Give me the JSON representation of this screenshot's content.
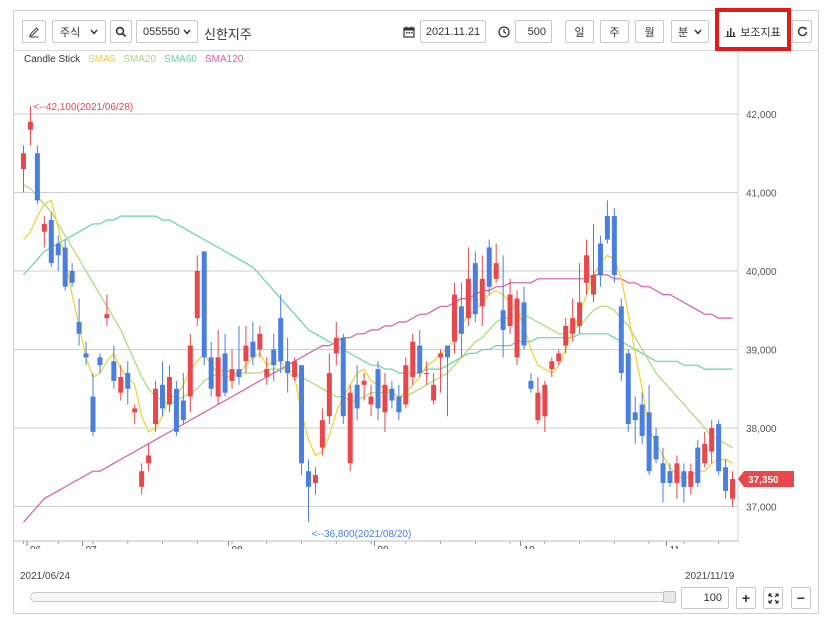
{
  "toolbar": {
    "edit_icon": "pencil-icon",
    "market_select": "주식",
    "search_icon": "search-icon",
    "code_select": "055550",
    "stock_name": "신한지주",
    "calendar_icon": "calendar-icon",
    "date_value": "2021.11.21",
    "clock_icon": "clock-icon",
    "count_value": "500",
    "period_day": "일",
    "period_week": "주",
    "period_month": "월",
    "period_minute": "분",
    "indicator_label": "보조지표",
    "refresh_icon": "refresh-icon"
  },
  "legend": {
    "candle": "Candle Stick",
    "sma5": "SMA5",
    "sma20": "SMA20",
    "sma60": "SMA60",
    "sma120": "SMA120"
  },
  "colors": {
    "up": "#e8474c",
    "down": "#4a7fe0",
    "sma5": "#f2d12e",
    "sma20": "#a9dc72",
    "sma60": "#66d6a6",
    "sma120": "#d65ea9",
    "highlight": "#e41919",
    "price_tag": "#e8474c"
  },
  "chart_data": {
    "type": "candlestick",
    "y_ticks": [
      "42,000",
      "41,000",
      "40,000",
      "39,000",
      "38,000",
      "37,000"
    ],
    "ylim": [
      36600,
      42400
    ],
    "x_ticks": [
      "06",
      "07",
      "08",
      "09",
      "10",
      "11"
    ],
    "high_annotation": "<--42,100(2021/06/28)",
    "low_annotation": "<--36,800(2021/08/20)",
    "current_price": "37,350",
    "start_date": "2021/06/24",
    "end_date": "2021/11/19",
    "candles": [
      [
        41300,
        41500,
        41000,
        41600,
        "u"
      ],
      [
        41800,
        41900,
        41600,
        42100,
        "u"
      ],
      [
        41500,
        40900,
        40850,
        41600,
        "d"
      ],
      [
        40500,
        40600,
        40300,
        40700,
        "u"
      ],
      [
        40650,
        40100,
        40050,
        40750,
        "d"
      ],
      [
        40350,
        40200,
        40000,
        40450,
        "d"
      ],
      [
        40300,
        39800,
        39750,
        40400,
        "d"
      ],
      [
        40000,
        39850,
        39800,
        40100,
        "d"
      ],
      [
        39350,
        39200,
        39050,
        39650,
        "d"
      ],
      [
        38950,
        38900,
        38800,
        39100,
        "d"
      ],
      [
        38400,
        37950,
        37900,
        38700,
        "d"
      ],
      [
        38900,
        38800,
        38700,
        38950,
        "d"
      ],
      [
        39400,
        39450,
        39300,
        39700,
        "u"
      ],
      [
        38850,
        38600,
        38500,
        39050,
        "d"
      ],
      [
        38450,
        38650,
        38350,
        38800,
        "u"
      ],
      [
        38700,
        38500,
        38300,
        38850,
        "d"
      ],
      [
        38200,
        38250,
        38050,
        38300,
        "u"
      ],
      [
        37250,
        37450,
        37150,
        37550,
        "u"
      ],
      [
        37550,
        37650,
        37450,
        37800,
        "u"
      ],
      [
        38050,
        38500,
        37950,
        38600,
        "u"
      ],
      [
        38550,
        38250,
        38150,
        38850,
        "d"
      ],
      [
        38300,
        38650,
        38200,
        38800,
        "u"
      ],
      [
        38500,
        37950,
        37900,
        38600,
        "d"
      ],
      [
        38350,
        38100,
        38050,
        38700,
        "d"
      ],
      [
        38400,
        39050,
        38200,
        39200,
        "u"
      ],
      [
        39400,
        40000,
        39300,
        40200,
        "u"
      ],
      [
        40250,
        38900,
        38800,
        40250,
        "d"
      ],
      [
        38900,
        38500,
        38400,
        39100,
        "d"
      ],
      [
        38400,
        38900,
        38300,
        39250,
        "u"
      ],
      [
        38950,
        38450,
        38400,
        39200,
        "d"
      ],
      [
        38600,
        38750,
        38500,
        39000,
        "u"
      ],
      [
        38750,
        38650,
        38550,
        39300,
        "d"
      ],
      [
        38850,
        39050,
        38700,
        39300,
        "u"
      ],
      [
        39100,
        38900,
        38800,
        39350,
        "d"
      ],
      [
        39000,
        39200,
        38900,
        39300,
        "u"
      ],
      [
        38650,
        38750,
        38550,
        38900,
        "u"
      ],
      [
        39000,
        38800,
        38600,
        39200,
        "d"
      ],
      [
        39400,
        38850,
        38700,
        39700,
        "d"
      ],
      [
        38850,
        38700,
        38450,
        39150,
        "d"
      ],
      [
        38650,
        38850,
        38600,
        38900,
        "u"
      ],
      [
        38800,
        37550,
        37400,
        38800,
        "d"
      ],
      [
        37450,
        37250,
        36800,
        37600,
        "d"
      ],
      [
        37300,
        37400,
        37150,
        37500,
        "u"
      ],
      [
        37750,
        38100,
        37650,
        38250,
        "u"
      ],
      [
        38150,
        38700,
        38050,
        38950,
        "u"
      ],
      [
        38950,
        39150,
        38800,
        39350,
        "u"
      ],
      [
        39150,
        38150,
        38050,
        39200,
        "d"
      ],
      [
        38450,
        37550,
        37450,
        38550,
        "u"
      ],
      [
        38550,
        38250,
        38100,
        38800,
        "d"
      ],
      [
        38550,
        38600,
        38350,
        38700,
        "u"
      ],
      [
        38300,
        38400,
        38150,
        38550,
        "u"
      ],
      [
        38750,
        38250,
        38100,
        38850,
        "d"
      ],
      [
        38550,
        38200,
        37950,
        38700,
        "u"
      ],
      [
        38500,
        38350,
        38250,
        38600,
        "d"
      ],
      [
        38400,
        38200,
        38100,
        38550,
        "d"
      ],
      [
        38300,
        38800,
        38250,
        38900,
        "u"
      ],
      [
        38650,
        39100,
        38550,
        39200,
        "u"
      ],
      [
        39050,
        38700,
        38650,
        39250,
        "d"
      ],
      [
        38700,
        38700,
        38550,
        38850,
        "u"
      ],
      [
        38350,
        38550,
        38300,
        38700,
        "u"
      ],
      [
        38950,
        38900,
        38450,
        39000,
        "u"
      ],
      [
        39050,
        38900,
        38150,
        39050,
        "d"
      ],
      [
        39100,
        39700,
        38950,
        39850,
        "u"
      ],
      [
        39550,
        39200,
        38900,
        39850,
        "d"
      ],
      [
        39400,
        39900,
        39300,
        40300,
        "u"
      ],
      [
        40100,
        39450,
        39350,
        40250,
        "d"
      ],
      [
        39550,
        39900,
        39300,
        40200,
        "u"
      ],
      [
        40300,
        39800,
        39700,
        40400,
        "d"
      ],
      [
        39900,
        40100,
        39850,
        40350,
        "u"
      ],
      [
        39500,
        39250,
        38900,
        40200,
        "d"
      ],
      [
        39700,
        39300,
        39200,
        39900,
        "u"
      ],
      [
        38900,
        39650,
        38800,
        39750,
        "u"
      ],
      [
        39600,
        39050,
        39000,
        39800,
        "d"
      ],
      [
        38600,
        38500,
        38450,
        38700,
        "d"
      ],
      [
        38450,
        38100,
        38050,
        38650,
        "u"
      ],
      [
        38550,
        38150,
        37950,
        38600,
        "u"
      ],
      [
        38750,
        38850,
        38650,
        38900,
        "u"
      ],
      [
        38850,
        38950,
        38800,
        39000,
        "u"
      ],
      [
        39050,
        39300,
        38950,
        39400,
        "u"
      ],
      [
        39200,
        39400,
        39100,
        39650,
        "u"
      ],
      [
        39300,
        39600,
        39200,
        40100,
        "u"
      ],
      [
        39850,
        40200,
        39700,
        40400,
        "u"
      ],
      [
        39700,
        39950,
        39600,
        40600,
        "u"
      ],
      [
        40350,
        39950,
        39800,
        40450,
        "d"
      ],
      [
        40700,
        40400,
        40350,
        40900,
        "d"
      ],
      [
        40700,
        39950,
        39850,
        40800,
        "d"
      ],
      [
        39550,
        38700,
        38600,
        39650,
        "d"
      ],
      [
        38950,
        38050,
        37950,
        39000,
        "d"
      ],
      [
        38100,
        38200,
        37800,
        38400,
        "d"
      ],
      [
        38300,
        37900,
        37800,
        38450,
        "d"
      ],
      [
        38200,
        37450,
        37400,
        38550,
        "d"
      ],
      [
        37900,
        37600,
        37550,
        38000,
        "d"
      ],
      [
        37550,
        37300,
        37050,
        37750,
        "d"
      ],
      [
        37450,
        37300,
        37250,
        37550,
        "d"
      ],
      [
        37300,
        37550,
        37100,
        37650,
        "u"
      ],
      [
        37450,
        37250,
        37050,
        37550,
        "d"
      ],
      [
        37250,
        37450,
        37150,
        37550,
        "u"
      ],
      [
        37750,
        37300,
        37250,
        37850,
        "d"
      ],
      [
        37550,
        37800,
        37500,
        37950,
        "u"
      ],
      [
        38000,
        37700,
        37550,
        38100,
        "u"
      ],
      [
        38050,
        37450,
        37400,
        38100,
        "d"
      ],
      [
        37500,
        37200,
        37100,
        37600,
        "d"
      ],
      [
        37100,
        37350,
        37000,
        37450,
        "u"
      ]
    ],
    "sma5": [
      40400,
      40500,
      40700,
      40850,
      40900,
      40550,
      40150,
      39700,
      39300,
      38900,
      38650,
      38700,
      38850,
      38950,
      38750,
      38650,
      38550,
      38150,
      37950,
      38000,
      38150,
      38400,
      38400,
      38550,
      38750,
      38850,
      38950,
      38800,
      38700,
      38650,
      38650,
      38700,
      38800,
      38900,
      38950,
      38800,
      38850,
      38850,
      38700,
      38650,
      38200,
      37850,
      37650,
      37700,
      37900,
      38200,
      38400,
      38550,
      38700,
      38750,
      38600,
      38550,
      38500,
      38450,
      38400,
      38450,
      38550,
      38650,
      38800,
      38850,
      38950,
      39000,
      39150,
      39300,
      39450,
      39500,
      39600,
      39700,
      39750,
      39700,
      39600,
      39500,
      39300,
      39000,
      38800,
      38750,
      38700,
      38800,
      39000,
      39250,
      39450,
      39700,
      39950,
      40100,
      40200,
      40150,
      39900,
      39450,
      38950,
      38500,
      38000,
      37800,
      37650,
      37500,
      37400,
      37350,
      37400,
      37450,
      37450,
      37550,
      37600,
      37600,
      37550
    ],
    "sma20": [
      41100,
      41050,
      40950,
      40850,
      40750,
      40600,
      40450,
      40300,
      40150,
      40000,
      39850,
      39700,
      39550,
      39400,
      39250,
      39050,
      38850,
      38650,
      38500,
      38400,
      38350,
      38300,
      38350,
      38400,
      38450,
      38500,
      38600,
      38650,
      38700,
      38750,
      38700,
      38700,
      38700,
      38700,
      38700,
      38750,
      38750,
      38750,
      38750,
      38700,
      38650,
      38600,
      38550,
      38500,
      38450,
      38400,
      38400,
      38350,
      38350,
      38400,
      38450,
      38450,
      38450,
      38450,
      38400,
      38400,
      38450,
      38500,
      38550,
      38600,
      38650,
      38700,
      38800,
      38900,
      39000,
      39100,
      39150,
      39250,
      39350,
      39400,
      39400,
      39450,
      39450,
      39400,
      39350,
      39300,
      39250,
      39200,
      39200,
      39250,
      39300,
      39400,
      39500,
      39550,
      39550,
      39500,
      39400,
      39300,
      39150,
      39000,
      38850,
      38700,
      38600,
      38500,
      38400,
      38300,
      38200,
      38100,
      38000,
      37900,
      37850,
      37800,
      37750
    ],
    "sma60": [
      39950,
      40050,
      40150,
      40250,
      40300,
      40350,
      40400,
      40450,
      40500,
      40550,
      40600,
      40600,
      40650,
      40650,
      40700,
      40700,
      40700,
      40700,
      40700,
      40700,
      40650,
      40650,
      40600,
      40550,
      40500,
      40450,
      40400,
      40350,
      40300,
      40250,
      40200,
      40150,
      40100,
      40050,
      39950,
      39850,
      39750,
      39650,
      39550,
      39450,
      39350,
      39250,
      39200,
      39150,
      39100,
      39050,
      39000,
      38950,
      38900,
      38850,
      38800,
      38800,
      38750,
      38750,
      38700,
      38700,
      38700,
      38700,
      38750,
      38750,
      38750,
      38800,
      38850,
      38900,
      38950,
      38950,
      39000,
      39000,
      39050,
      39050,
      39050,
      39100,
      39100,
      39100,
      39150,
      39150,
      39150,
      39150,
      39150,
      39150,
      39200,
      39200,
      39200,
      39200,
      39200,
      39150,
      39100,
      39050,
      39000,
      38950,
      38900,
      38850,
      38850,
      38850,
      38850,
      38800,
      38800,
      38800,
      38750,
      38750,
      38750,
      38750,
      38750
    ],
    "sma120": [
      36800,
      36900,
      37000,
      37100,
      37150,
      37200,
      37250,
      37300,
      37350,
      37400,
      37450,
      37450,
      37500,
      37550,
      37600,
      37650,
      37700,
      37750,
      37800,
      37850,
      37900,
      37950,
      38000,
      38050,
      38100,
      38150,
      38200,
      38250,
      38300,
      38350,
      38400,
      38450,
      38500,
      38550,
      38600,
      38650,
      38700,
      38750,
      38800,
      38850,
      38900,
      38950,
      39000,
      39050,
      39050,
      39100,
      39150,
      39150,
      39200,
      39200,
      39250,
      39250,
      39300,
      39300,
      39350,
      39350,
      39400,
      39450,
      39450,
      39500,
      39550,
      39550,
      39600,
      39650,
      39650,
      39700,
      39750,
      39750,
      39800,
      39800,
      39850,
      39850,
      39850,
      39850,
      39900,
      39900,
      39900,
      39900,
      39900,
      39900,
      39900,
      39900,
      39950,
      39950,
      39950,
      39900,
      39900,
      39850,
      39850,
      39800,
      39800,
      39750,
      39700,
      39700,
      39650,
      39600,
      39550,
      39500,
      39450,
      39450,
      39400,
      39400,
      39400
    ]
  },
  "footer": {
    "zoom_value": "100",
    "zoom_in_label": "+",
    "fit_icon": "expand-icon",
    "zoom_out_label": "−"
  }
}
